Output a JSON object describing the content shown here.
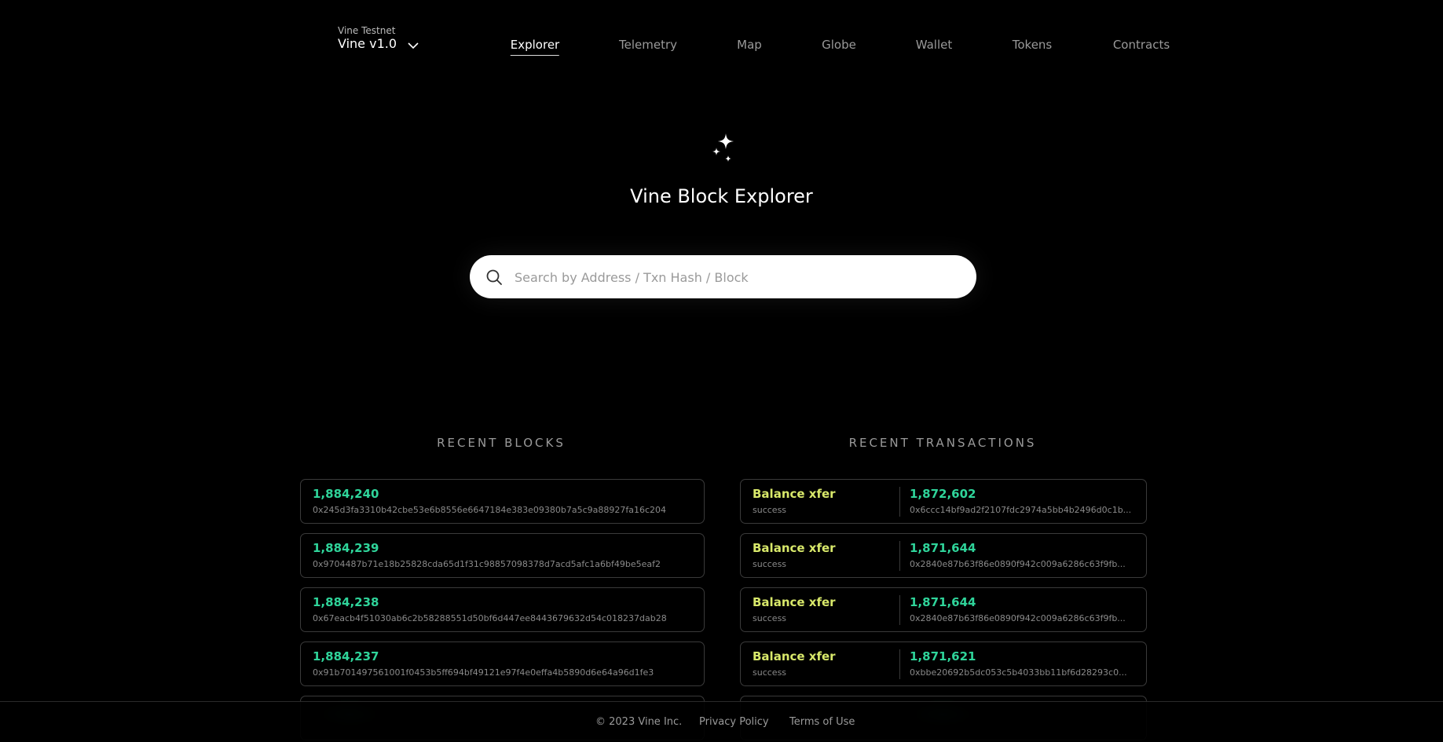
{
  "network": {
    "label": "Vine Testnet",
    "version": "Vine v1.0"
  },
  "nav": [
    "Explorer",
    "Telemetry",
    "Map",
    "Globe",
    "Wallet",
    "Tokens",
    "Contracts"
  ],
  "hero": {
    "title": "Vine Block Explorer"
  },
  "search": {
    "placeholder": "Search by Address / Txn Hash / Block"
  },
  "recent_blocks": {
    "title": "RECENT BLOCKS",
    "items": [
      {
        "number": "1,884,240",
        "hash": "0x245d3fa3310b42cbe53e6b8556e6647184e383e09380b7a5c9a88927fa16c204"
      },
      {
        "number": "1,884,239",
        "hash": "0x9704487b71e18b25828cda65d1f31c98857098378d7acd5afc1a6bf49be5eaf2"
      },
      {
        "number": "1,884,238",
        "hash": "0x67eacb4f51030ab6c2b58288551d50bf6d447ee8443679632d54c018237dab28"
      },
      {
        "number": "1,884,237",
        "hash": "0x91b701497561001f0453b5ff694bf49121e97f4e0effa4b5890d6e64a96d1fe3"
      }
    ]
  },
  "recent_transactions": {
    "title": "RECENT TRANSACTIONS",
    "items": [
      {
        "type": "Balance xfer",
        "status": "success",
        "block": "1,872,602",
        "hash": "0x6ccc14bf9ad2f2107fdc2974a5bb4b2496d0c1b..."
      },
      {
        "type": "Balance xfer",
        "status": "success",
        "block": "1,871,644",
        "hash": "0x2840e87b63f86e0890f942c009a6286c63f9fb..."
      },
      {
        "type": "Balance xfer",
        "status": "success",
        "block": "1,871,644",
        "hash": "0x2840e87b63f86e0890f942c009a6286c63f9fb..."
      },
      {
        "type": "Balance xfer",
        "status": "success",
        "block": "1,871,621",
        "hash": "0xbbe20692b5dc053c5b4033bb11bf6d28293c0..."
      }
    ]
  },
  "footer": {
    "copyright": "© 2023 Vine Inc.",
    "privacy": "Privacy Policy",
    "terms": "Terms of Use"
  },
  "colors": {
    "accent_green": "#2fd49a",
    "accent_yellow": "#d8e86a",
    "background": "#000000"
  },
  "icons": {
    "network_dropdown": "chevron-down-icon",
    "hero": "sparkles-icon",
    "search": "search-icon"
  }
}
